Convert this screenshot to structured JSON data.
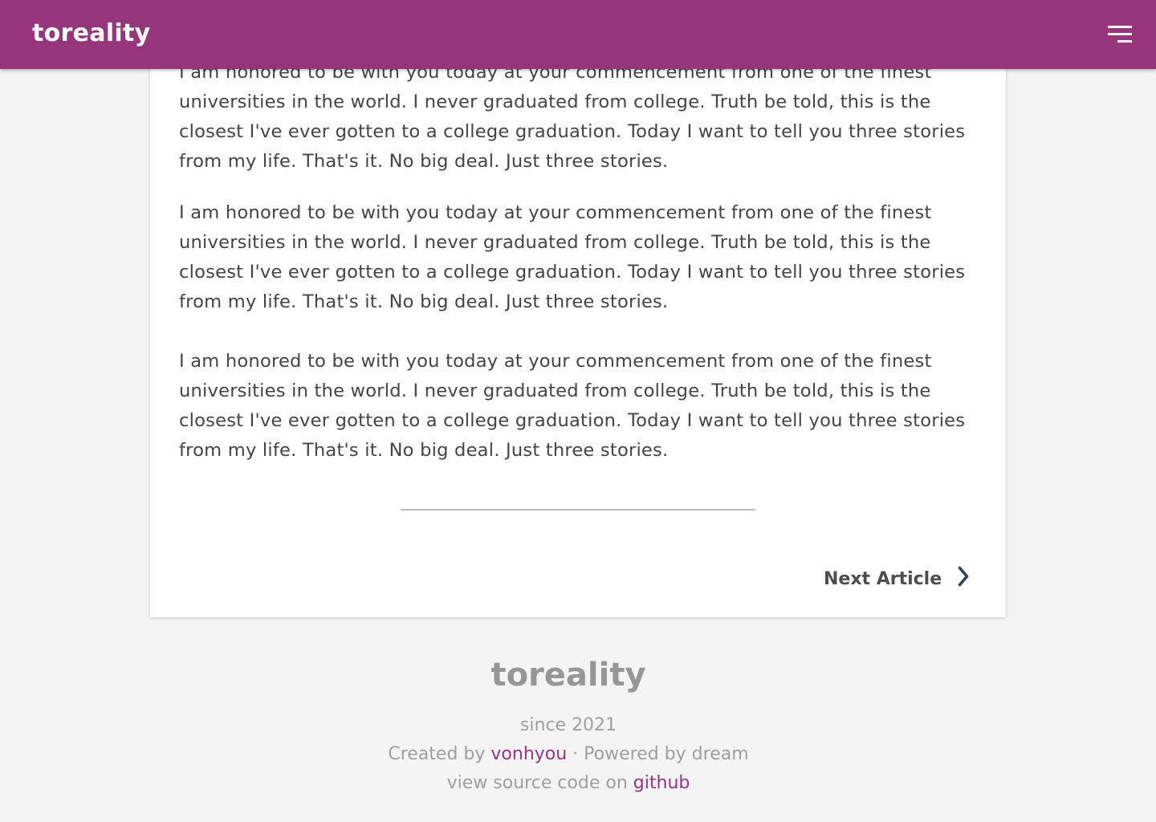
{
  "header": {
    "brand": "toreality",
    "menu_icon": "hamburger-menu-icon",
    "color": "#97357c"
  },
  "article": {
    "paragraphs": [
      "I am honored to be with you today at your commencement from one of the finest universities in the world. I never graduated from college. Truth be told, this is the closest I've ever gotten to a college graduation. Today I want to tell you three stories from my life. That's it. No big deal. Just three stories.",
      "I am honored to be with you today at your commencement from one of the finest universities in the world. I never graduated from college. Truth be told, this is the closest I've ever gotten to a college graduation. Today I want to tell you three stories from my life. That's it. No big deal. Just three stories.",
      "I am honored to be with you today at your commencement from one of the finest universities in the world. I never graduated from college. Truth be told, this is the closest I've ever gotten to a college graduation. Today I want to tell you three stories from my life. That's it. No big deal. Just three stories."
    ],
    "next_label": "Next Article",
    "next_icon": "chevron-right-icon"
  },
  "footer": {
    "brand": "toreality",
    "since": "since 2021",
    "created_prefix": "Created by ",
    "author": "vonhyou",
    "powered": " · Powered by dream",
    "source_prefix": "view source code on ",
    "source_link": "github",
    "link_color": "#97357c"
  }
}
